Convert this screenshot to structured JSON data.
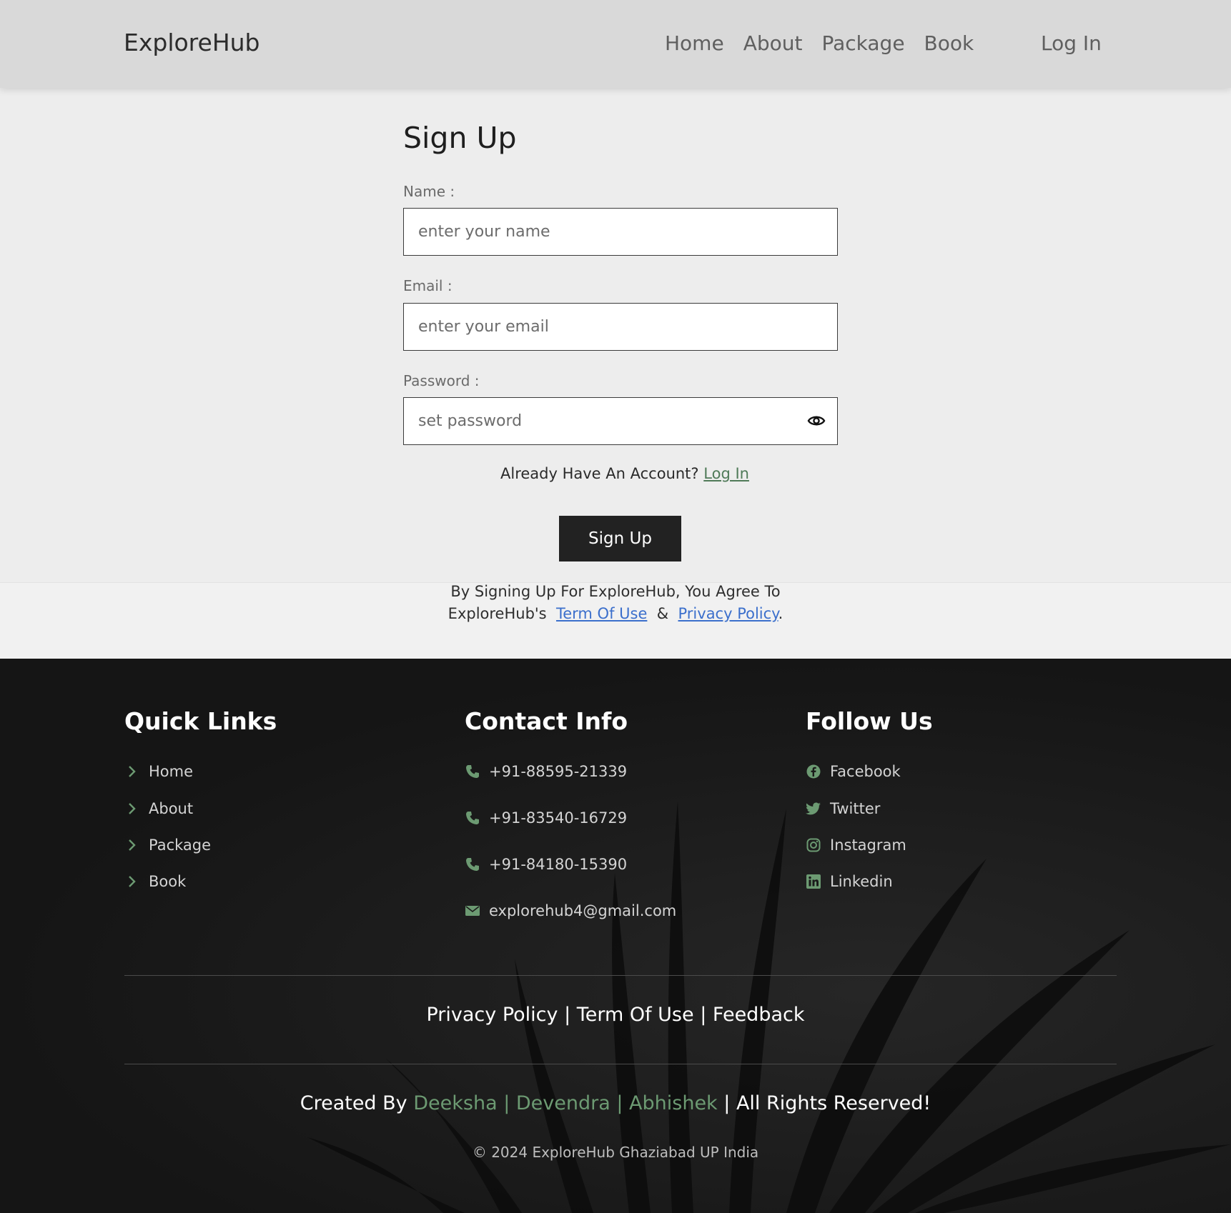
{
  "header": {
    "logo": "ExploreHub",
    "nav": [
      "Home",
      "About",
      "Package",
      "Book"
    ],
    "login": "Log In"
  },
  "form": {
    "title": "Sign Up",
    "name_label": "Name :",
    "name_placeholder": "enter your name",
    "email_label": "Email :",
    "email_placeholder": "enter your email",
    "password_label": "Password :",
    "password_placeholder": "set password",
    "account_text": "Already Have An Account?",
    "account_link": "Log In",
    "submit": "Sign Up"
  },
  "terms": {
    "line1": "By Signing Up For ExploreHub, You Agree To",
    "prefix": "ExploreHub's",
    "term_link": "Term Of Use",
    "amp": "&",
    "privacy_link": "Privacy Policy",
    "suffix": "."
  },
  "footer": {
    "quick_links_title": "Quick Links",
    "quick_links": [
      "Home",
      "About",
      "Package",
      "Book"
    ],
    "contact_title": "Contact Info",
    "phones": [
      "+91-88595-21339",
      "+91-83540-16729",
      "+91-84180-15390"
    ],
    "email": "explorehub4@gmail.com",
    "follow_title": "Follow Us",
    "social": [
      {
        "label": "Facebook",
        "icon": "facebook-icon"
      },
      {
        "label": "Twitter",
        "icon": "twitter-icon"
      },
      {
        "label": "Instagram",
        "icon": "instagram-icon"
      },
      {
        "label": "Linkedin",
        "icon": "linkedin-icon"
      }
    ],
    "legal": [
      "Privacy Policy",
      "Term Of Use",
      "Feedback"
    ],
    "legal_sep": "|",
    "credits_prefix": "Created By",
    "credits_names": "Deeksha | Devendra | Abhishek",
    "credits_suffix": "| All Rights Reserved!",
    "copyright": "© 2024 ExploreHub Ghaziabad UP India"
  },
  "colors": {
    "accent_green": "#6c9a72",
    "link_blue": "#3b6fcc",
    "footer_bg": "#1a1a1a",
    "header_bg": "#d9d9d9"
  }
}
